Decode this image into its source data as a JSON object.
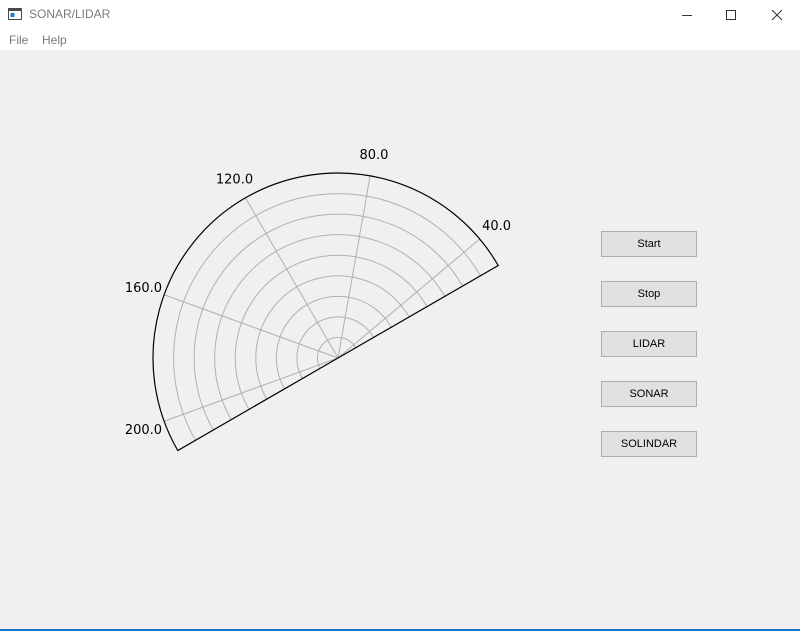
{
  "window": {
    "title": "SONAR/LIDAR",
    "icons": {
      "app": "app-window-icon",
      "minimize": "minimize-icon",
      "maximize": "maximize-icon",
      "close": "close-icon"
    }
  },
  "menu": {
    "items": [
      "File",
      "Help"
    ]
  },
  "polar_plot": {
    "theta_min_deg": 30,
    "theta_max_deg": 210,
    "radial_gridlines": 8,
    "angle_tick_labels": [
      "40.0",
      "80.0",
      "120.0",
      "160.0",
      "200.0"
    ],
    "grid": true
  },
  "buttons": {
    "start": "Start",
    "stop": "Stop",
    "lidar": "LIDAR",
    "sonar": "SONAR",
    "solindar": "SOLINDAR"
  },
  "colors": {
    "grid": "#b0b0b0",
    "frame": "#000000",
    "button_bg": "#e1e1e1",
    "button_border": "#adadad"
  }
}
